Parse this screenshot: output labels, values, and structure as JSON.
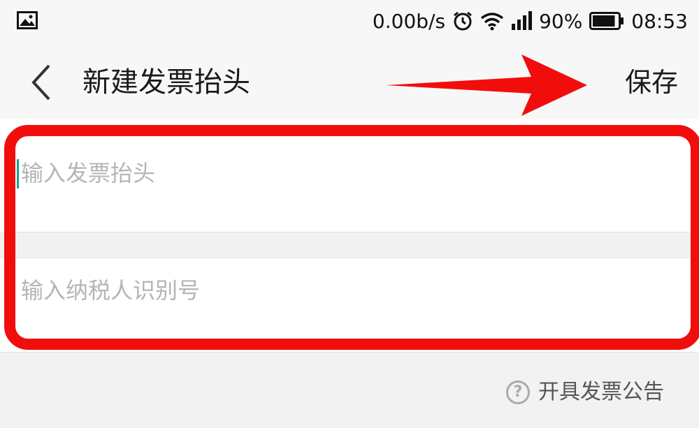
{
  "status_bar": {
    "net_speed": "0.00b/s",
    "battery_percent": "90%",
    "battery_level": 0.9,
    "time": "08:53",
    "icons": [
      "gallery-icon",
      "alarm-icon",
      "wifi-icon",
      "signal-icon",
      "battery-icon"
    ]
  },
  "header": {
    "back_icon": "chevron-left-icon",
    "title": "新建发票抬头",
    "save_label": "保存"
  },
  "form": {
    "title_placeholder": "输入发票抬头",
    "title_value": "",
    "tax_id_placeholder": "输入纳税人识别号",
    "tax_id_value": ""
  },
  "footer": {
    "notice_icon": "help-circle-icon",
    "notice_icon_glyph": "?",
    "notice_label": "开具发票公告"
  },
  "colors": {
    "annotation": "#f20d0d",
    "caret": "#1aa089",
    "placeholder": "#b5b5b5",
    "background": "#f2f2f2"
  }
}
